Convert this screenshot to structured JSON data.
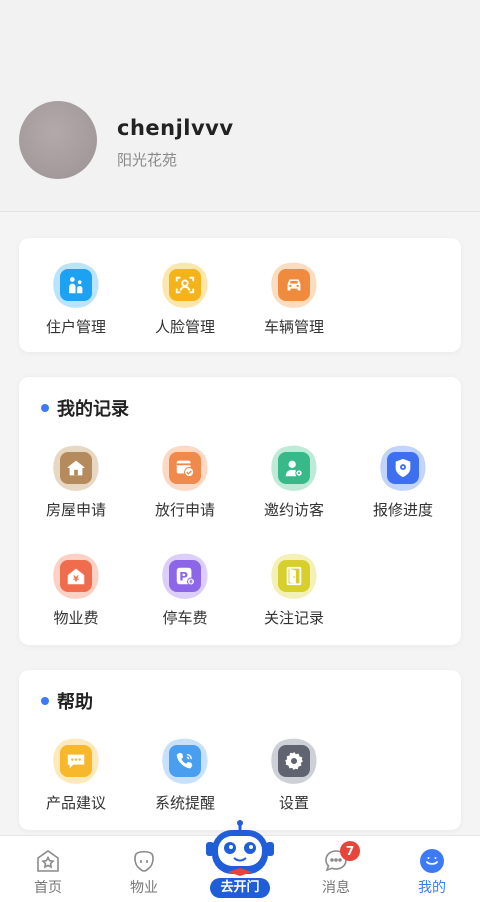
{
  "profile": {
    "username": "chenjlvvv",
    "community": "阳光花苑"
  },
  "quick_actions": [
    {
      "label": "住户管理",
      "icon": "family-icon",
      "color": "#1da1f2",
      "blob": "#7fcdf8"
    },
    {
      "label": "人脸管理",
      "icon": "face-scan-icon",
      "color": "#f5b31a",
      "blob": "#f8d36c"
    },
    {
      "label": "车辆管理",
      "icon": "car-icon",
      "color": "#f08a3c",
      "blob": "#f6bf8c"
    }
  ],
  "records": {
    "title": "我的记录",
    "items": [
      {
        "label": "房屋申请",
        "icon": "house-icon",
        "color": "#b58a5c",
        "blob": "#d1b892"
      },
      {
        "label": "放行申请",
        "icon": "pass-check-icon",
        "color": "#f08a4c",
        "blob": "#f7b994"
      },
      {
        "label": "邀约访客",
        "icon": "visitor-icon",
        "color": "#38b98a",
        "blob": "#8ad8b8"
      },
      {
        "label": "报修进度",
        "icon": "repair-shield-icon",
        "color": "#3d6ff0",
        "blob": "#8fb0f8"
      },
      {
        "label": "物业费",
        "icon": "fee-house-icon",
        "color": "#ef6d4c",
        "blob": "#f6ab94"
      },
      {
        "label": "停车费",
        "icon": "parking-fee-icon",
        "color": "#8c65e8",
        "blob": "#bda6f3"
      },
      {
        "label": "关注记录",
        "icon": "door-icon",
        "color": "#d6cf2c",
        "blob": "#e9e47e"
      }
    ]
  },
  "help": {
    "title": "帮助",
    "items": [
      {
        "label": "产品建议",
        "icon": "suggestion-chat-icon",
        "color": "#f7b82c",
        "blob": "#fbd780"
      },
      {
        "label": "系统提醒",
        "icon": "phone-icon",
        "color": "#4a9ef0",
        "blob": "#9bc9f7"
      },
      {
        "label": "设置",
        "icon": "gear-icon",
        "color": "#5f6470",
        "blob": "#a4a9b4"
      }
    ]
  },
  "tabbar": {
    "items": [
      {
        "label": "首页",
        "icon": "home-star-icon"
      },
      {
        "label": "物业",
        "icon": "property-icon"
      },
      {
        "label": "去开门",
        "icon": "robot-open-door-icon"
      },
      {
        "label": "消息",
        "icon": "message-icon",
        "badge": "7"
      },
      {
        "label": "我的",
        "icon": "profile-smile-icon"
      }
    ],
    "active_color": "#3d7bf6"
  }
}
